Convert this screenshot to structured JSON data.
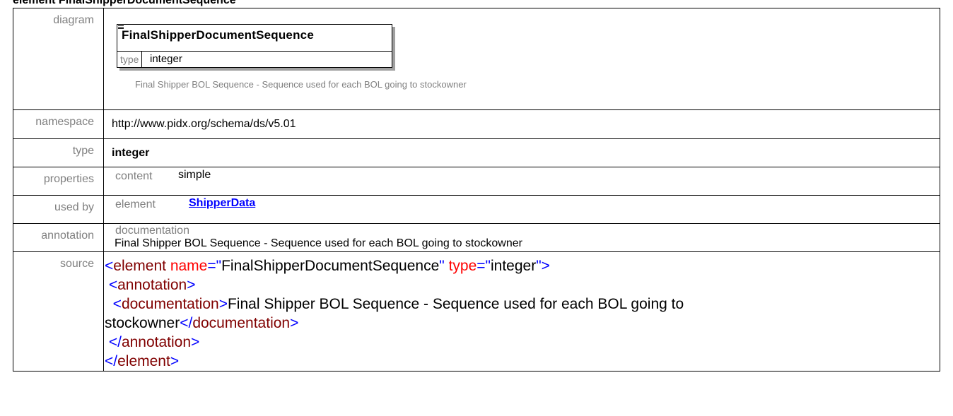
{
  "heading": "element FinalShipperDocumentSequence",
  "rows": {
    "diagram": {
      "label": "diagram",
      "box_title": "FinalShipperDocumentSequence",
      "type_label": "type",
      "type_value": "integer",
      "caption": "Final Shipper BOL Sequence - Sequence used for each BOL going to stockowner"
    },
    "namespace": {
      "label": "namespace",
      "value": "http://www.pidx.org/schema/ds/v5.01"
    },
    "type": {
      "label": "type",
      "value": "integer"
    },
    "properties": {
      "label": "properties",
      "key": "content",
      "value": "simple"
    },
    "used_by": {
      "label": "used by",
      "key": "element",
      "link": "ShipperData"
    },
    "annotation": {
      "label": "annotation",
      "key": "documentation",
      "value": "Final Shipper BOL Sequence - Sequence used for each BOL going to stockowner"
    },
    "source": {
      "label": "source",
      "line1": {
        "lt": "<",
        "tag": "element",
        "attr1": " name",
        "eq1": "=\"",
        "val1": "FinalShipperDocumentSequence",
        "q1": "\"",
        "attr2": " type",
        "eq2": "=\"",
        "val2": "integer",
        "end": "\">"
      },
      "line2": {
        "indent": " ",
        "lt": "<",
        "tag": "annotation",
        "gt": ">"
      },
      "line3": {
        "indent": "  ",
        "lt": "<",
        "tag": "documentation",
        "gt": ">",
        "text": "Final Shipper BOL Sequence - Sequence used for each BOL going to"
      },
      "line4": {
        "text": "stockowner",
        "lt": "</",
        "tag": "documentation",
        "gt": ">"
      },
      "line5": {
        "indent": " ",
        "lt": "</",
        "tag": "annotation",
        "gt": ">"
      },
      "line6": {
        "lt": "</",
        "tag": "element",
        "gt": ">"
      }
    }
  },
  "colors": {
    "label_gray": "#808080",
    "bracket_blue": "#0000ff",
    "tag_maroon": "#800000",
    "attr_red": "#ff0000",
    "link_blue": "#0000ff"
  }
}
